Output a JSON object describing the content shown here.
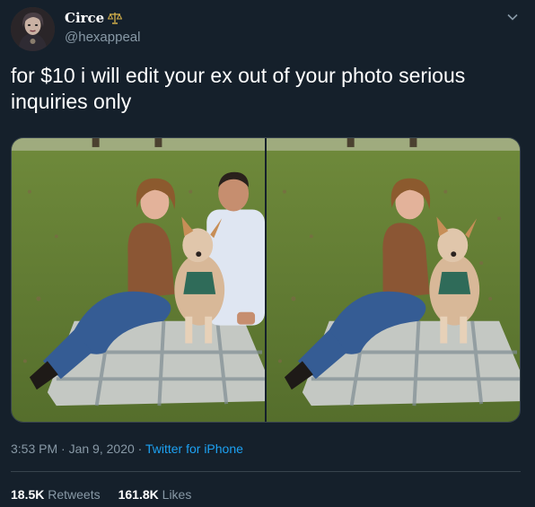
{
  "tweet": {
    "display_name": "Circe",
    "name_badge_icon": "scales-icon",
    "handle": "@hexappeal",
    "text": "for $10 i will edit your ex out of your photo serious inquiries only",
    "time": "3:53 PM",
    "date": "Jan 9, 2020",
    "separator": "·",
    "source": "Twitter for iPhone",
    "retweets_count": "18.5K",
    "retweets_label": "Retweets",
    "likes_count": "161.8K",
    "likes_label": "Likes"
  },
  "media": {
    "photo_before_icon": "couple-with-dog-photo",
    "photo_after_icon": "woman-with-dog-photo"
  },
  "colors": {
    "background": "#15202b",
    "secondary_text": "#8899a6",
    "link": "#1da1f2",
    "border": "#38444d"
  }
}
